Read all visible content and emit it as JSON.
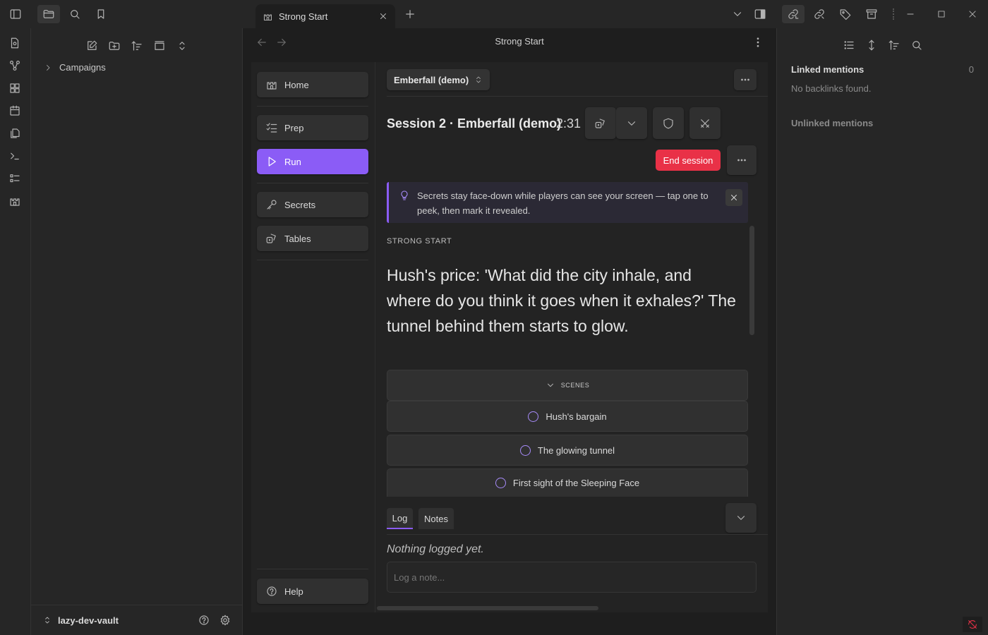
{
  "titlebar": {
    "tab_title": "Strong Start",
    "icons": [
      "sidebar-left-icon",
      "folder-icon",
      "search-icon",
      "bookmark-icon",
      "plus-icon",
      "chevron-down-icon",
      "sidebar-right-icon",
      "link-icon",
      "link-off-icon",
      "tag-icon",
      "archive-icon",
      "minimize-icon",
      "maximize-icon",
      "close-icon"
    ]
  },
  "ribbon": {
    "icons": [
      "file-icon",
      "graph-icon",
      "blocks-icon",
      "calendar-icon",
      "copy-icon",
      "terminal-icon",
      "list-icon",
      "castle-icon"
    ]
  },
  "left_sidebar": {
    "tree": [
      {
        "label": "Campaigns",
        "expanded": false
      }
    ],
    "vault_name": "lazy-dev-vault"
  },
  "view": {
    "title": "Strong Start"
  },
  "nav": {
    "items": [
      {
        "label": "Home",
        "icon": "castle-icon",
        "active": false
      },
      {
        "label": "Prep",
        "icon": "checklist-icon",
        "active": false
      },
      {
        "label": "Run",
        "icon": "play-icon",
        "active": true
      },
      {
        "label": "Secrets",
        "icon": "key-icon",
        "active": false
      },
      {
        "label": "Tables",
        "icon": "dice-icon",
        "active": false
      }
    ],
    "help_label": "Help"
  },
  "session": {
    "campaign": "Emberfall (demo)",
    "title": "Session 2 · Emberfall (demo)",
    "timer": "2:31",
    "end_session_label": "End session",
    "hint": "Secrets stay face-down while players can see your screen — tap one to peek, then mark it revealed.",
    "section_label": "STRONG START",
    "strong_start": "Hush's price: 'What did the city inhale, and where do you think it goes when it exhales?' The tunnel behind them starts to glow.",
    "scenes_label": "SCENES",
    "scenes": [
      "Hush's bargain",
      "The glowing tunnel",
      "First sight of the Sleeping Face"
    ],
    "log_tabs": [
      "Log",
      "Notes"
    ],
    "log_empty": "Nothing logged yet.",
    "log_placeholder": "Log a note..."
  },
  "right_sidebar": {
    "linked_label": "Linked mentions",
    "linked_count": "0",
    "no_backlinks": "No backlinks found.",
    "unlinked_label": "Unlinked mentions"
  },
  "colors": {
    "accent": "#8b5cf6",
    "danger": "#e93147",
    "background": "#1e1e1e",
    "panel": "#262626"
  }
}
